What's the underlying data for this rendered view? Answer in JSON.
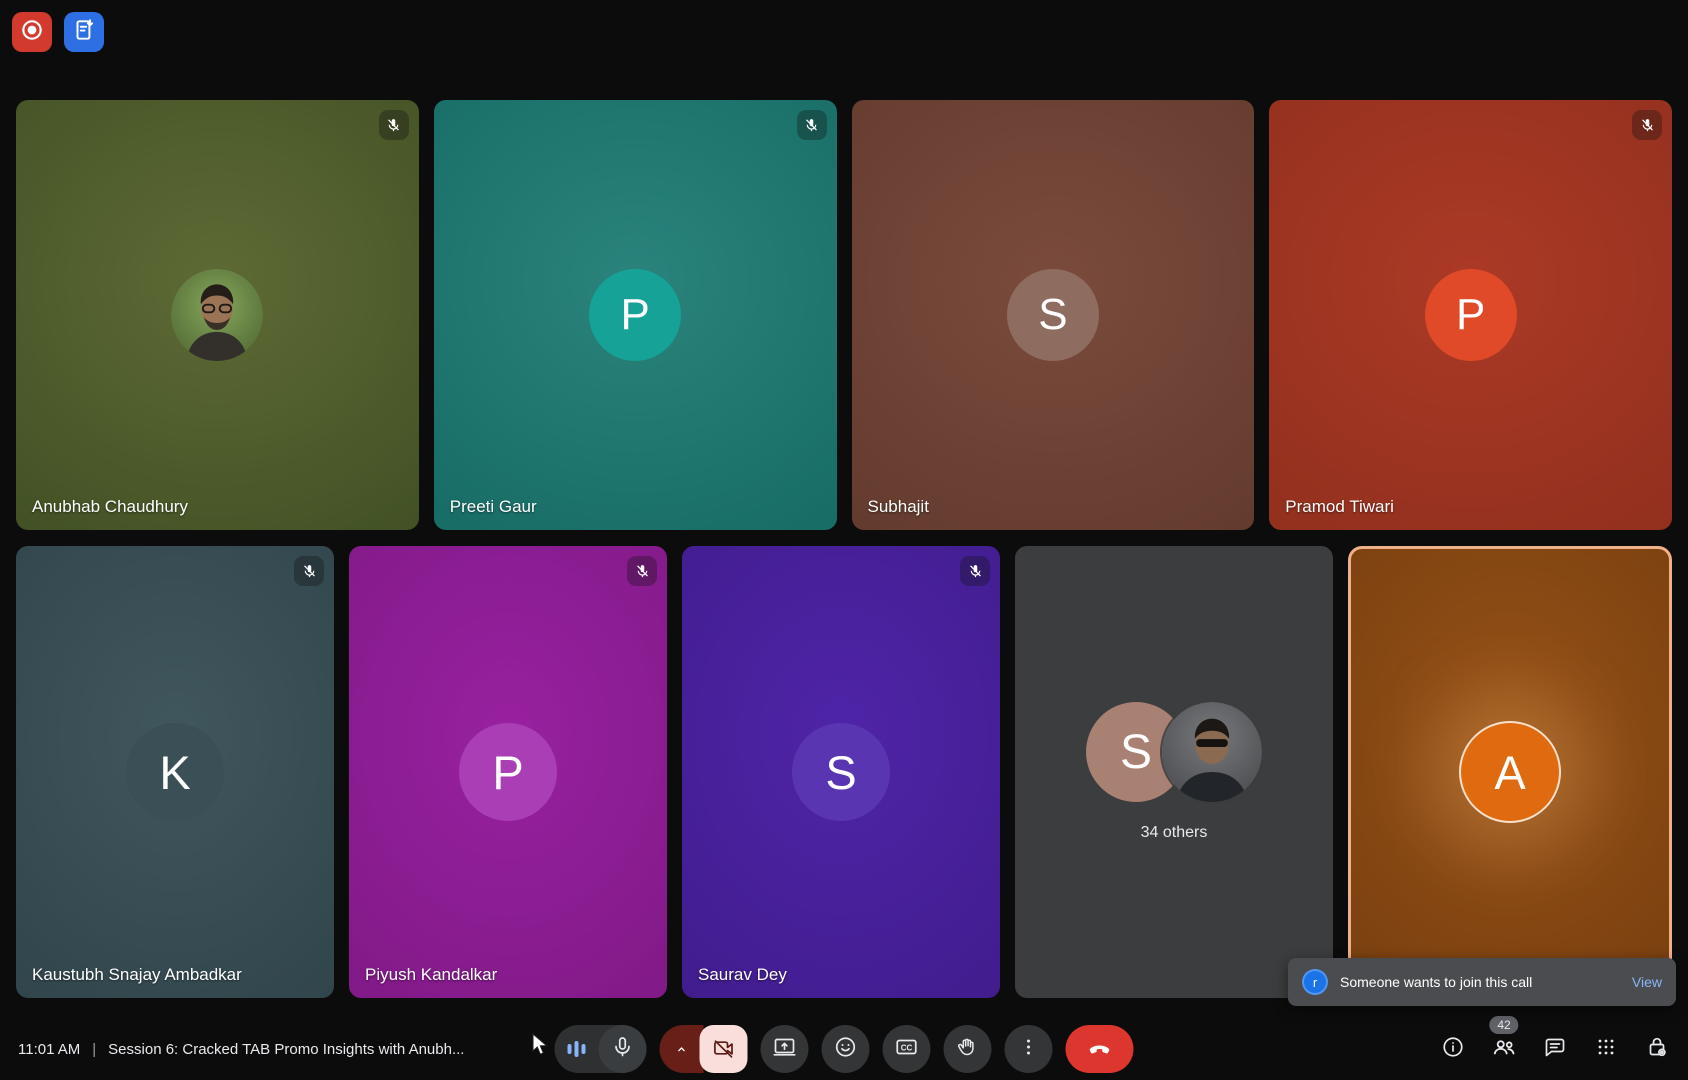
{
  "top_left_buttons": [
    {
      "icon": "record-icon",
      "color": "#d33a2e"
    },
    {
      "icon": "transcript-icon",
      "color": "#2f6fe4"
    }
  ],
  "participants": [
    {
      "name": "Anubhab Chaudhury",
      "initial": "",
      "muted": true,
      "has_photo": true,
      "bg_center": "#5e6a35",
      "bg_edge": "#394920",
      "avatar_color": "#6f8f4a"
    },
    {
      "name": "Preeti Gaur",
      "initial": "P",
      "muted": true,
      "bg_center": "#2a837c",
      "bg_edge": "#11655e",
      "avatar_color": "#16a296"
    },
    {
      "name": "Subhajit",
      "initial": "S",
      "muted": false,
      "bg_center": "#7a4b3c",
      "bg_edge": "#5c362a",
      "avatar_color": "#8f6c60"
    },
    {
      "name": "Pramod Tiwari",
      "initial": "P",
      "muted": true,
      "bg_center": "#ab3a26",
      "bg_edge": "#8a2c1b",
      "avatar_color": "#e04a28"
    },
    {
      "name": "Kaustubh Snajay Ambadkar",
      "initial": "K",
      "muted": true,
      "bg_center": "#40575d",
      "bg_edge": "#2c4046",
      "avatar_color": "#3a5056"
    },
    {
      "name": "Piyush Kandalkar",
      "initial": "P",
      "muted": true,
      "bg_center": "#98219f",
      "bg_edge": "#7a1780",
      "avatar_color": "#a93eb5"
    },
    {
      "name": "Saurav Dey",
      "initial": "S",
      "muted": true,
      "bg_center": "#4f24a8",
      "bg_edge": "#3c1a85",
      "avatar_color": "#5a35b2"
    },
    {
      "name": "",
      "initial": "A",
      "muted": false,
      "highlighted": true,
      "bg_center": "#975217",
      "bg_edge": "#6e390d",
      "avatar_color": "#e06a10"
    }
  ],
  "others_tile": {
    "count_label": "34 others",
    "initial": "S",
    "bg": "#3b3d3e",
    "avatar_color": "#a88172"
  },
  "toast": {
    "avatar_letter": "r",
    "message": "Someone wants to join this call",
    "action_label": "View"
  },
  "bottom_bar": {
    "time": "11:01 AM",
    "separator": "|",
    "meeting_title": "Session 6: Cracked TAB Promo Insights with Anubh..."
  },
  "panel_badge": {
    "count": "42"
  },
  "colors": {
    "accent_blue": "#8ab4f8",
    "danger_red": "#dc362e",
    "camera_off_bg": "#f9dedc",
    "camera_caret_bg": "#681f17",
    "toast_avatar": "#1a73e8",
    "toast_link": "#8ab4f8",
    "tile_active_border": "#f0b089",
    "badge_bg": "#5f6368"
  }
}
